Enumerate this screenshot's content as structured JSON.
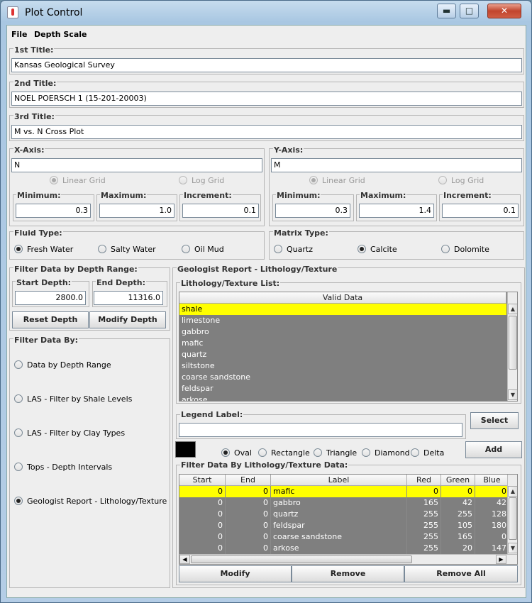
{
  "window": {
    "title": "Plot Control",
    "min_glyph": "▬",
    "max_glyph": "□",
    "close_glyph": "✕"
  },
  "menu": [
    "File",
    "Depth Scale"
  ],
  "titles": {
    "first": {
      "label": "1st Title:",
      "value": "Kansas Geological Survey"
    },
    "second": {
      "label": "2nd Title:",
      "value": "NOEL POERSCH 1 (15-201-20003)"
    },
    "third": {
      "label": "3rd Title:",
      "value": "M vs. N Cross Plot"
    }
  },
  "xaxis": {
    "label": "X-Axis:",
    "value": "N",
    "linear": "Linear Grid",
    "log": "Log Grid",
    "min_label": "Minimum:",
    "min": "0.3",
    "max_label": "Maximum:",
    "max": "1.0",
    "inc_label": "Increment:",
    "inc": "0.1"
  },
  "yaxis": {
    "label": "Y-Axis:",
    "value": "M",
    "linear": "Linear Grid",
    "log": "Log Grid",
    "min_label": "Minimum:",
    "min": "0.3",
    "max_label": "Maximum:",
    "max": "1.4",
    "inc_label": "Increment:",
    "inc": "0.1"
  },
  "fluid": {
    "label": "Fluid Type:",
    "options": [
      "Fresh Water",
      "Salty Water",
      "Oil Mud"
    ]
  },
  "matrix": {
    "label": "Matrix Type:",
    "options": [
      "Quartz",
      "Calcite",
      "Dolomite"
    ]
  },
  "depth": {
    "label": "Filter Data by Depth Range:",
    "start_label": "Start Depth:",
    "start": "2800.0",
    "end_label": "End Depth:",
    "end": "11316.0",
    "reset": "Reset Depth",
    "modify": "Modify Depth"
  },
  "filterby": {
    "label": "Filter Data By:",
    "options": [
      "Data by Depth Range",
      "LAS - Filter by Shale Levels",
      "LAS - Filter by Clay Types",
      "Tops - Depth Intervals",
      "Geologist Report - Lithology/Texture"
    ]
  },
  "geo": {
    "label": "Geologist Report - Lithology/Texture",
    "list_label": "Lithology/Texture List:",
    "list_header": "Valid Data",
    "list": [
      "shale",
      "limestone",
      "gabbro",
      "mafic",
      "quartz",
      "siltstone",
      "coarse sandstone",
      "feldspar",
      "arkose"
    ],
    "legend_label": "Legend Label:",
    "legend_value": "",
    "select": "Select",
    "shapes": [
      "Oval",
      "Rectangle",
      "Triangle",
      "Diamond",
      "Delta"
    ],
    "add": "Add",
    "color": "#000000",
    "table_label": "Filter Data By Lithology/Texture Data:",
    "headers": [
      "Start",
      "End",
      "Label",
      "Red",
      "Green",
      "Blue"
    ],
    "rows": [
      [
        "0",
        "0",
        "mafic",
        "0",
        "0",
        "0"
      ],
      [
        "0",
        "0",
        "gabbro",
        "165",
        "42",
        "42"
      ],
      [
        "0",
        "0",
        "quartz",
        "255",
        "255",
        "128"
      ],
      [
        "0",
        "0",
        "feldspar",
        "255",
        "105",
        "180"
      ],
      [
        "0",
        "0",
        "coarse sandstone",
        "255",
        "165",
        "0"
      ],
      [
        "0",
        "0",
        "arkose",
        "255",
        "20",
        "147"
      ]
    ],
    "modify": "Modify",
    "remove": "Remove",
    "remove_all": "Remove All"
  },
  "colors": {
    "selection": "#ffff00",
    "row_bg": "#7f7f7f"
  }
}
